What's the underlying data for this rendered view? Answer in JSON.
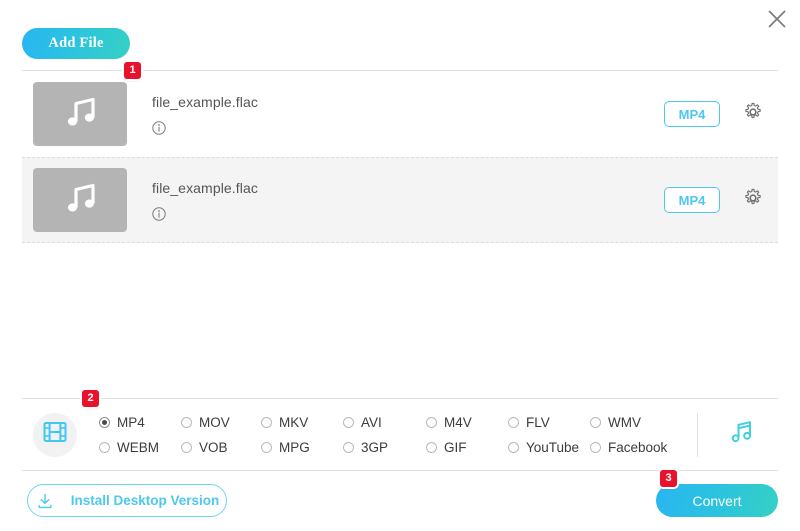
{
  "window": {
    "close_label": "×"
  },
  "toolbar": {
    "add_file_label": "Add File"
  },
  "badges": [
    {
      "id": "step-1",
      "label": "1"
    },
    {
      "id": "step-2",
      "label": "2"
    },
    {
      "id": "step-3",
      "label": "3"
    }
  ],
  "files": [
    {
      "name": "file_example.flac",
      "format_badge": "MP4",
      "thumb_icon": "music-note-icon",
      "info_icon": "info-icon",
      "settings_icon": "gear-icon",
      "highlighted": false
    },
    {
      "name": "file_example.flac",
      "format_badge": "MP4",
      "thumb_icon": "music-note-icon",
      "info_icon": "info-icon",
      "settings_icon": "gear-icon",
      "highlighted": true
    }
  ],
  "formats": {
    "category_icon": "film-strip-icon",
    "audio_icon": "music-note-icon",
    "selected": "MP4",
    "options": [
      {
        "label": "MP4",
        "checked": true
      },
      {
        "label": "MOV",
        "checked": false
      },
      {
        "label": "MKV",
        "checked": false
      },
      {
        "label": "AVI",
        "checked": false
      },
      {
        "label": "M4V",
        "checked": false
      },
      {
        "label": "FLV",
        "checked": false
      },
      {
        "label": "WMV",
        "checked": false
      },
      {
        "label": "WEBM",
        "checked": false
      },
      {
        "label": "VOB",
        "checked": false
      },
      {
        "label": "MPG",
        "checked": false
      },
      {
        "label": "3GP",
        "checked": false
      },
      {
        "label": "GIF",
        "checked": false
      },
      {
        "label": "YouTube",
        "checked": false
      },
      {
        "label": "Facebook",
        "checked": false
      }
    ]
  },
  "footer": {
    "install_label": "Install Desktop Version",
    "install_icon": "download-icon",
    "convert_label": "Convert"
  },
  "colors": {
    "accent": "#4ec8ef",
    "gradient_start": "#29b6f0",
    "gradient_end": "#35d0c4",
    "badge_red": "#e8132b",
    "thumb_gray": "#b4b4b4",
    "row_highlight": "#f4f4f4"
  }
}
